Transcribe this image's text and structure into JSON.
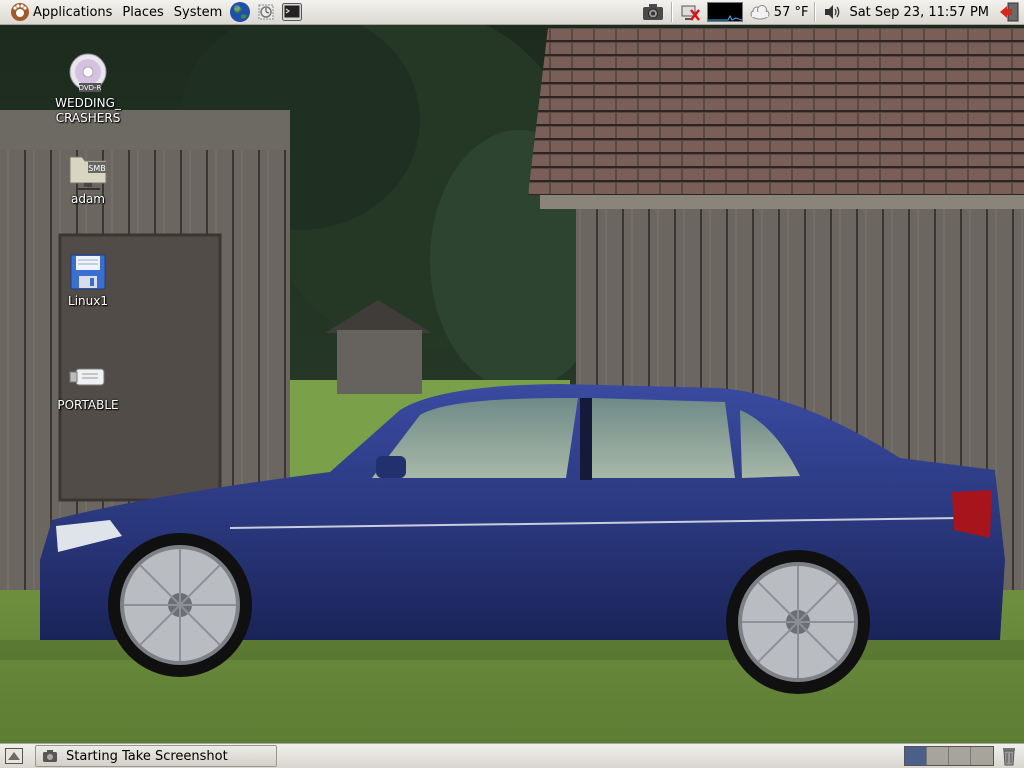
{
  "top_panel": {
    "menus": [
      {
        "label": "Applications",
        "icon": "gnome-foot-icon"
      },
      {
        "label": "Places"
      },
      {
        "label": "System"
      }
    ],
    "launchers": [
      "web-browser-globe-icon",
      "mail-stamp-icon",
      "terminal-icon"
    ],
    "tray": {
      "screenshot_icon": "camera-icon",
      "network_icon": "network-disconnected-icon",
      "weather_icon": "weather-cloud-icon",
      "temperature": "57 °F",
      "volume_icon": "speaker-volume-icon",
      "clock": "Sat Sep 23, 11:57 PM",
      "logout_icon": "logout-exit-icon"
    }
  },
  "desktop": {
    "icons": [
      {
        "label": "WEDDING_\nCRASHERS",
        "icon": "dvd-r-disc-icon"
      },
      {
        "label": "adam",
        "icon": "smb-network-folder-icon"
      },
      {
        "label": "Linux1",
        "icon": "floppy-disk-icon"
      },
      {
        "label": "PORTABLE",
        "icon": "usb-drive-icon"
      }
    ]
  },
  "bottom_panel": {
    "show_desktop_icon": "show-desktop-icon",
    "task_button": {
      "label": "Starting Take Screenshot",
      "icon": "camera-small-icon"
    },
    "workspaces": 4,
    "active_workspace": 1,
    "trash_icon": "trash-icon"
  },
  "colors": {
    "panel_bg": "#dcd9d2",
    "car_blue": "#2b3980",
    "active_workspace": "#4b5f8a"
  }
}
